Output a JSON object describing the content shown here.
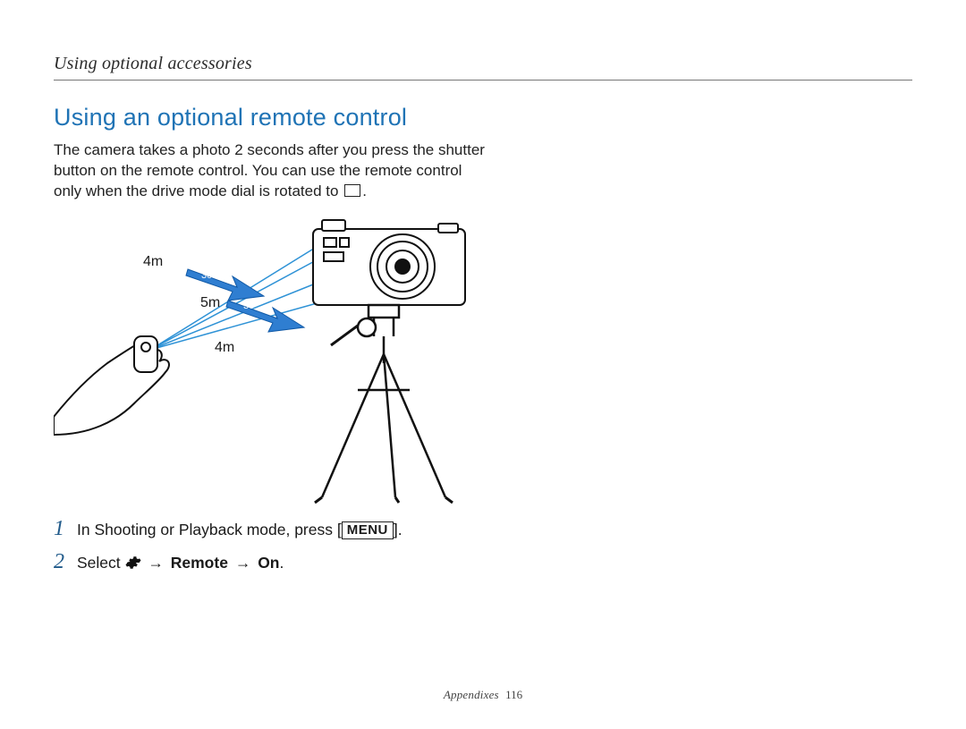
{
  "header": {
    "section": "Using optional accessories"
  },
  "title": "Using an optional remote control",
  "body": {
    "line1": "The camera takes a photo 2 seconds after you press the shutter",
    "line2": "button on the remote control. You can use the remote control",
    "line3a": "only when the drive mode dial is rotated to ",
    "line3b": "."
  },
  "diagram": {
    "range_top": "4m",
    "range_mid": "5m",
    "range_bot": "4m",
    "angle_top": "30˚",
    "angle_bot": "30˚"
  },
  "steps": [
    {
      "num": "1",
      "pre": "In Shooting or Playback mode, press [",
      "menu": "MENU",
      "post": "]."
    },
    {
      "num": "2",
      "pre": "Select ",
      "path1": "Remote",
      "path2": "On",
      "post": "."
    }
  ],
  "footer": {
    "label": "Appendixes",
    "page": "116"
  }
}
